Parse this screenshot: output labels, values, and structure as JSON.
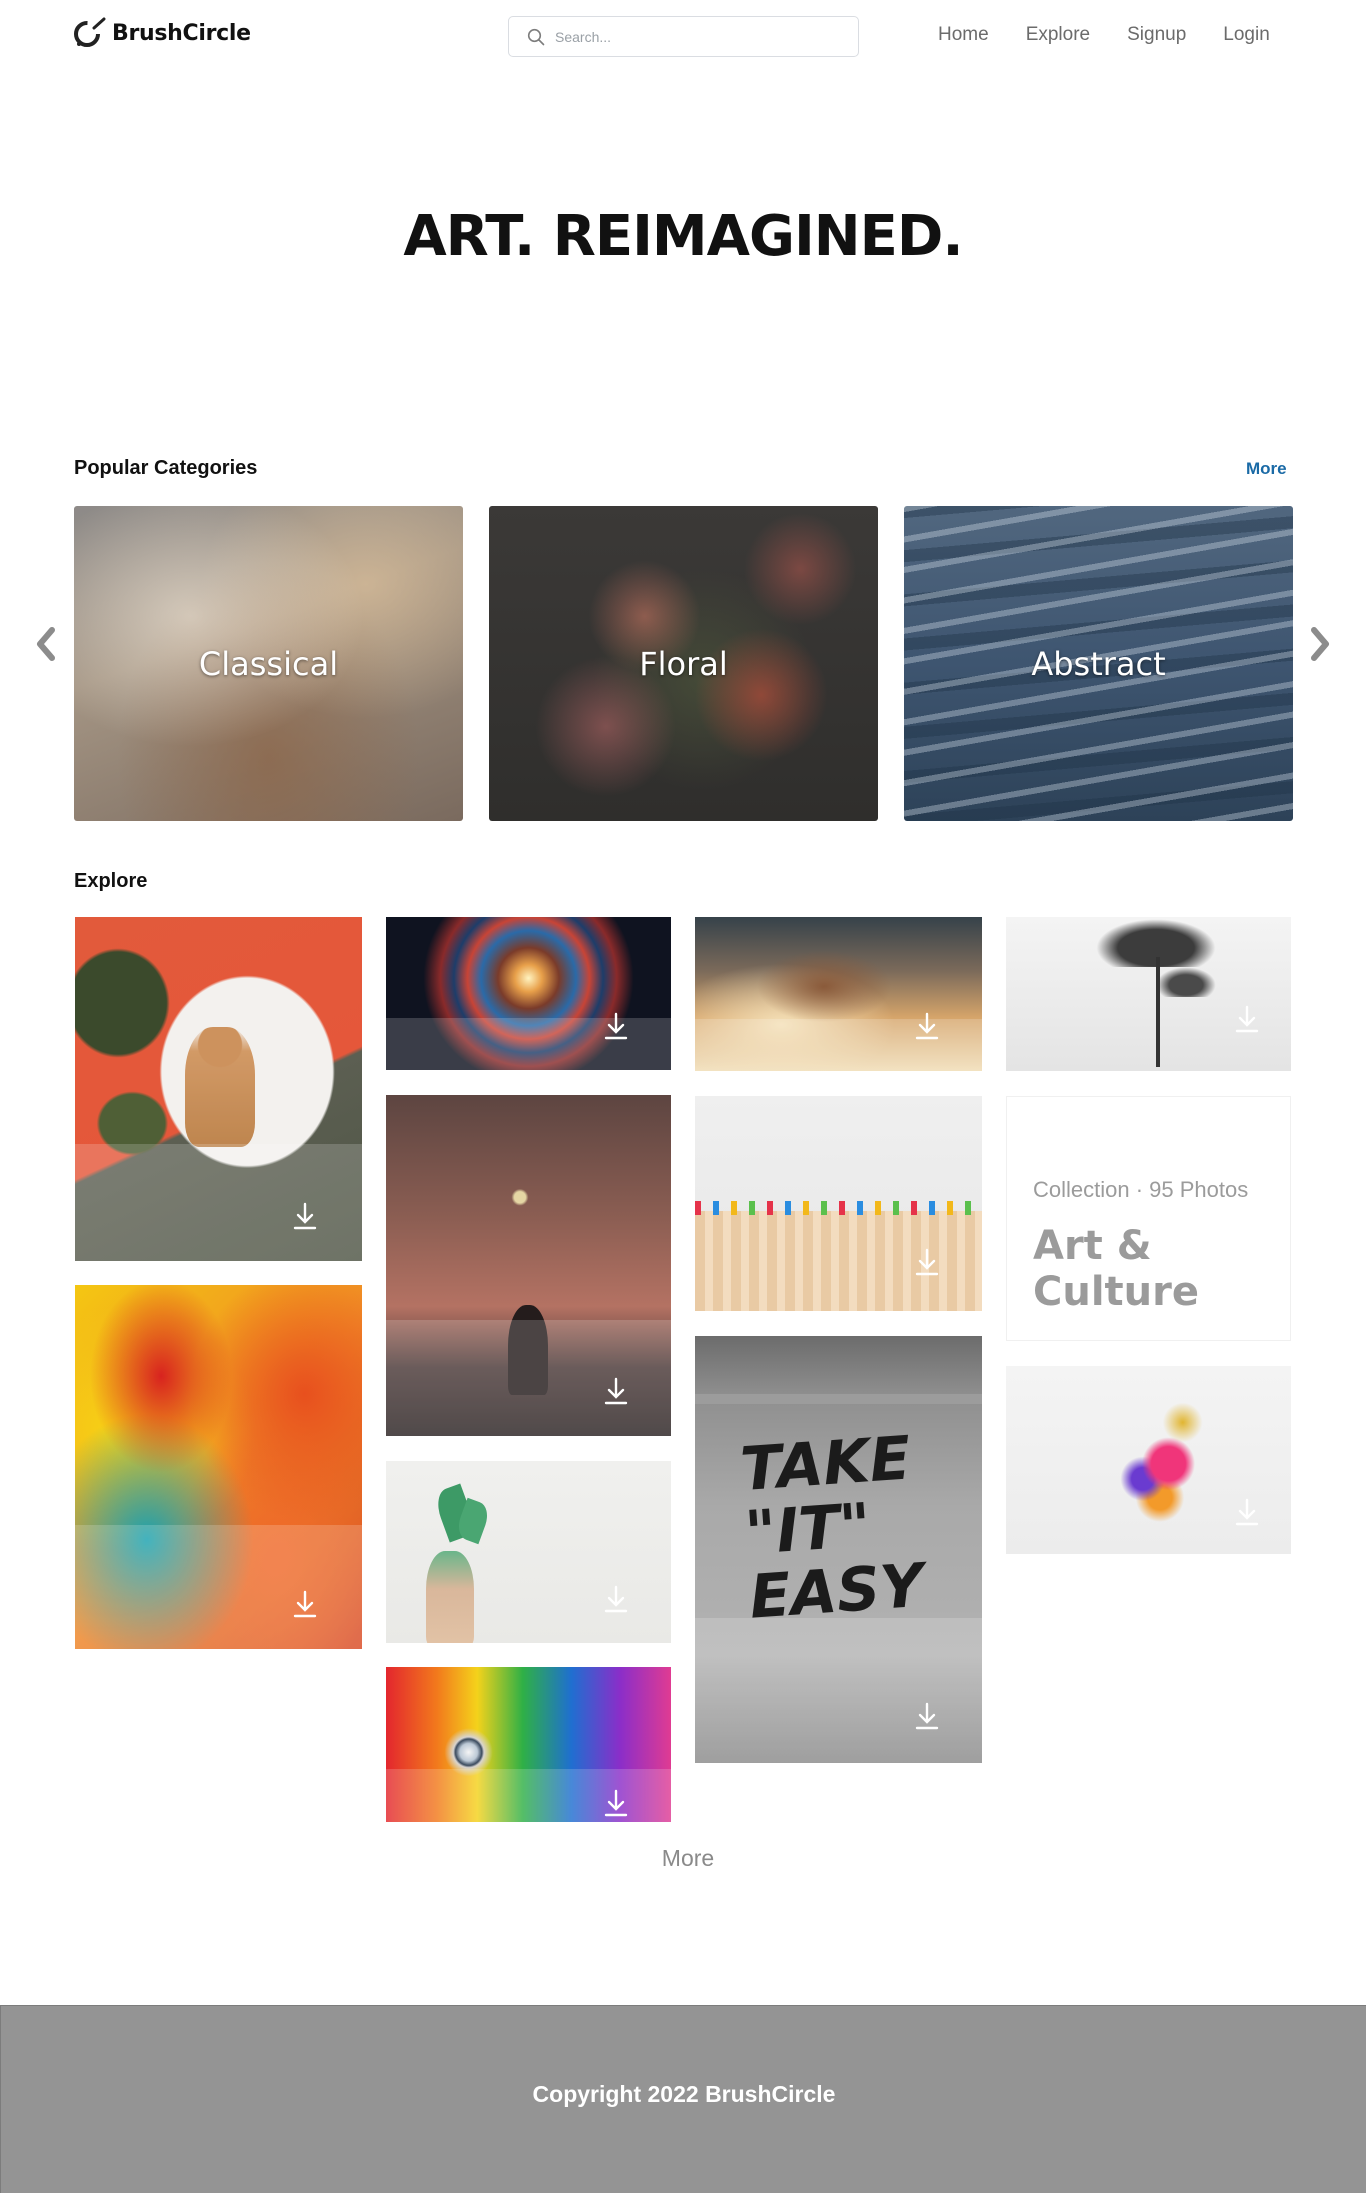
{
  "header": {
    "brand": "BrushCircle",
    "search_placeholder": "Search...",
    "nav": [
      "Home",
      "Explore",
      "Signup",
      "Login"
    ]
  },
  "hero": {
    "title": "ART. REIMAGINED."
  },
  "categories": {
    "title": "Popular Categories",
    "more_label": "More",
    "items": [
      "Classical",
      "Floral",
      "Abstract"
    ]
  },
  "explore": {
    "title": "Explore",
    "collection": {
      "meta": "Collection · 95 Photos",
      "title": "Art & Culture"
    },
    "graffiti_text": "TAKE \"IT\" EASY",
    "more_label": "More"
  },
  "footer": {
    "text": "Copyright 2022 BrushCircle"
  },
  "colors": {
    "accent_link": "#1a6aa6",
    "footer_bg": "#949494",
    "nav_text": "#6b6b6b"
  },
  "icons": [
    "logo-icon",
    "search-icon",
    "chevron-left-icon",
    "chevron-right-icon",
    "download-icon"
  ]
}
